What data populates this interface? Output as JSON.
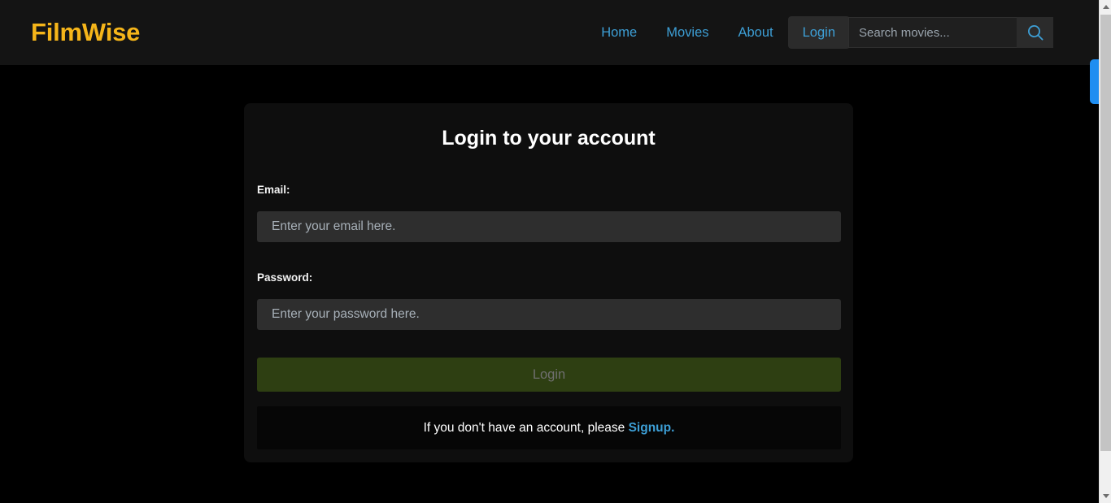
{
  "header": {
    "brand": "FilmWise",
    "nav": [
      {
        "label": "Home",
        "active": false
      },
      {
        "label": "Movies",
        "active": false
      },
      {
        "label": "About",
        "active": false
      },
      {
        "label": "Login",
        "active": true
      }
    ],
    "search": {
      "placeholder": "Search movies...",
      "value": "",
      "icon": "search-icon"
    }
  },
  "login_card": {
    "title": "Login to your account",
    "email": {
      "label": "Email:",
      "placeholder": "Enter your email here.",
      "value": ""
    },
    "password": {
      "label": "Password:",
      "placeholder": "Enter your password here.",
      "value": ""
    },
    "submit_label": "Login",
    "signup_prompt": "If you don't have an account, please ",
    "signup_link": "Signup."
  },
  "colors": {
    "brand": "#f5b51a",
    "accent_blue": "#3d9fd6",
    "header_bg": "#141414",
    "page_bg": "#000000",
    "card_bg": "#0e0e0e",
    "input_bg": "#2e2e2e",
    "button_bg": "#2e3f12",
    "button_text": "#6f6f6f",
    "edge_handle": "#1f8ef1"
  }
}
